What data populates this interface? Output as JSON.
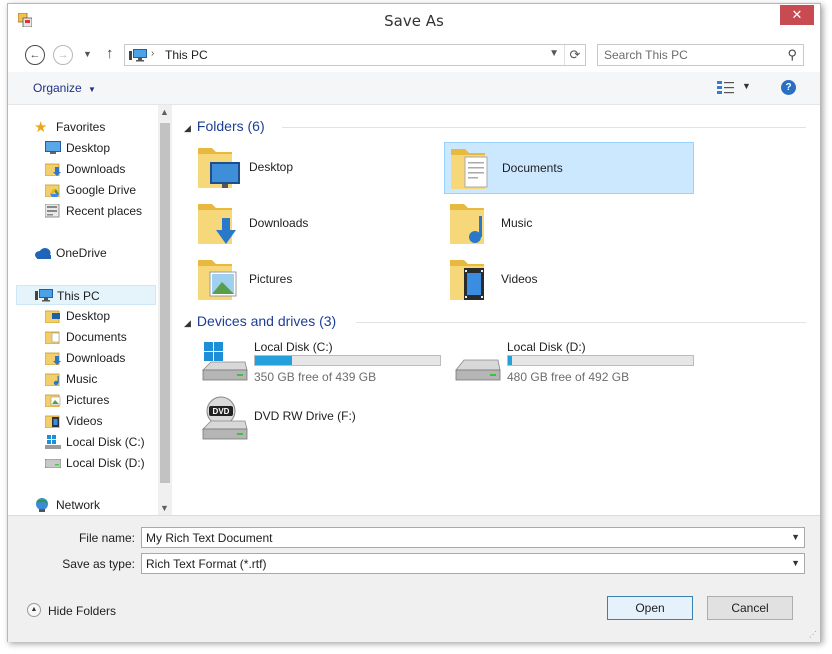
{
  "window": {
    "title": "Save As",
    "close_glyph": "✕",
    "app_icon": "save-dialog-icon"
  },
  "nav": {
    "back_icon": "back-arrow-icon",
    "forward_icon": "forward-arrow-icon",
    "recent_icon": "chevron-down-icon",
    "up_icon": "up-arrow-icon",
    "path_sep": "›",
    "location": "This PC"
  },
  "search": {
    "placeholder": "Search This PC"
  },
  "toolbar": {
    "organize_label": "Organize"
  },
  "sidebar": {
    "favorites": {
      "label": "Favorites",
      "items": [
        {
          "label": "Desktop"
        },
        {
          "label": "Downloads"
        },
        {
          "label": "Google Drive"
        },
        {
          "label": "Recent places"
        }
      ]
    },
    "onedrive": {
      "label": "OneDrive"
    },
    "thispc": {
      "label": "This PC",
      "items": [
        {
          "label": "Desktop"
        },
        {
          "label": "Documents"
        },
        {
          "label": "Downloads"
        },
        {
          "label": "Music"
        },
        {
          "label": "Pictures"
        },
        {
          "label": "Videos"
        },
        {
          "label": "Local Disk (C:)"
        },
        {
          "label": "Local Disk (D:)"
        }
      ]
    },
    "network": {
      "label": "Network"
    }
  },
  "content": {
    "folders_header": "Folders (6)",
    "folders": [
      {
        "label": "Desktop"
      },
      {
        "label": "Documents"
      },
      {
        "label": "Downloads"
      },
      {
        "label": "Music"
      },
      {
        "label": "Pictures"
      },
      {
        "label": "Videos"
      }
    ],
    "devices_header": "Devices and drives (3)",
    "drives": [
      {
        "name": "Local Disk (C:)",
        "free": "350 GB free of 439 GB",
        "used_fraction": 0.2
      },
      {
        "name": "Local Disk (D:)",
        "free": "480 GB free of 492 GB",
        "used_fraction": 0.024
      },
      {
        "name": "DVD RW Drive (F:)"
      }
    ]
  },
  "form": {
    "filename_label": "File name:",
    "filename_value": "My Rich Text Document",
    "type_label": "Save as type:",
    "type_value": "Rich Text Format (*.rtf)",
    "hide_folders_label": "Hide Folders",
    "open_label": "Open",
    "cancel_label": "Cancel"
  },
  "colors": {
    "accent": "#26a0da",
    "selection": "#cce8ff",
    "header_blue": "#1e3e94",
    "close_red": "#c74b50"
  }
}
